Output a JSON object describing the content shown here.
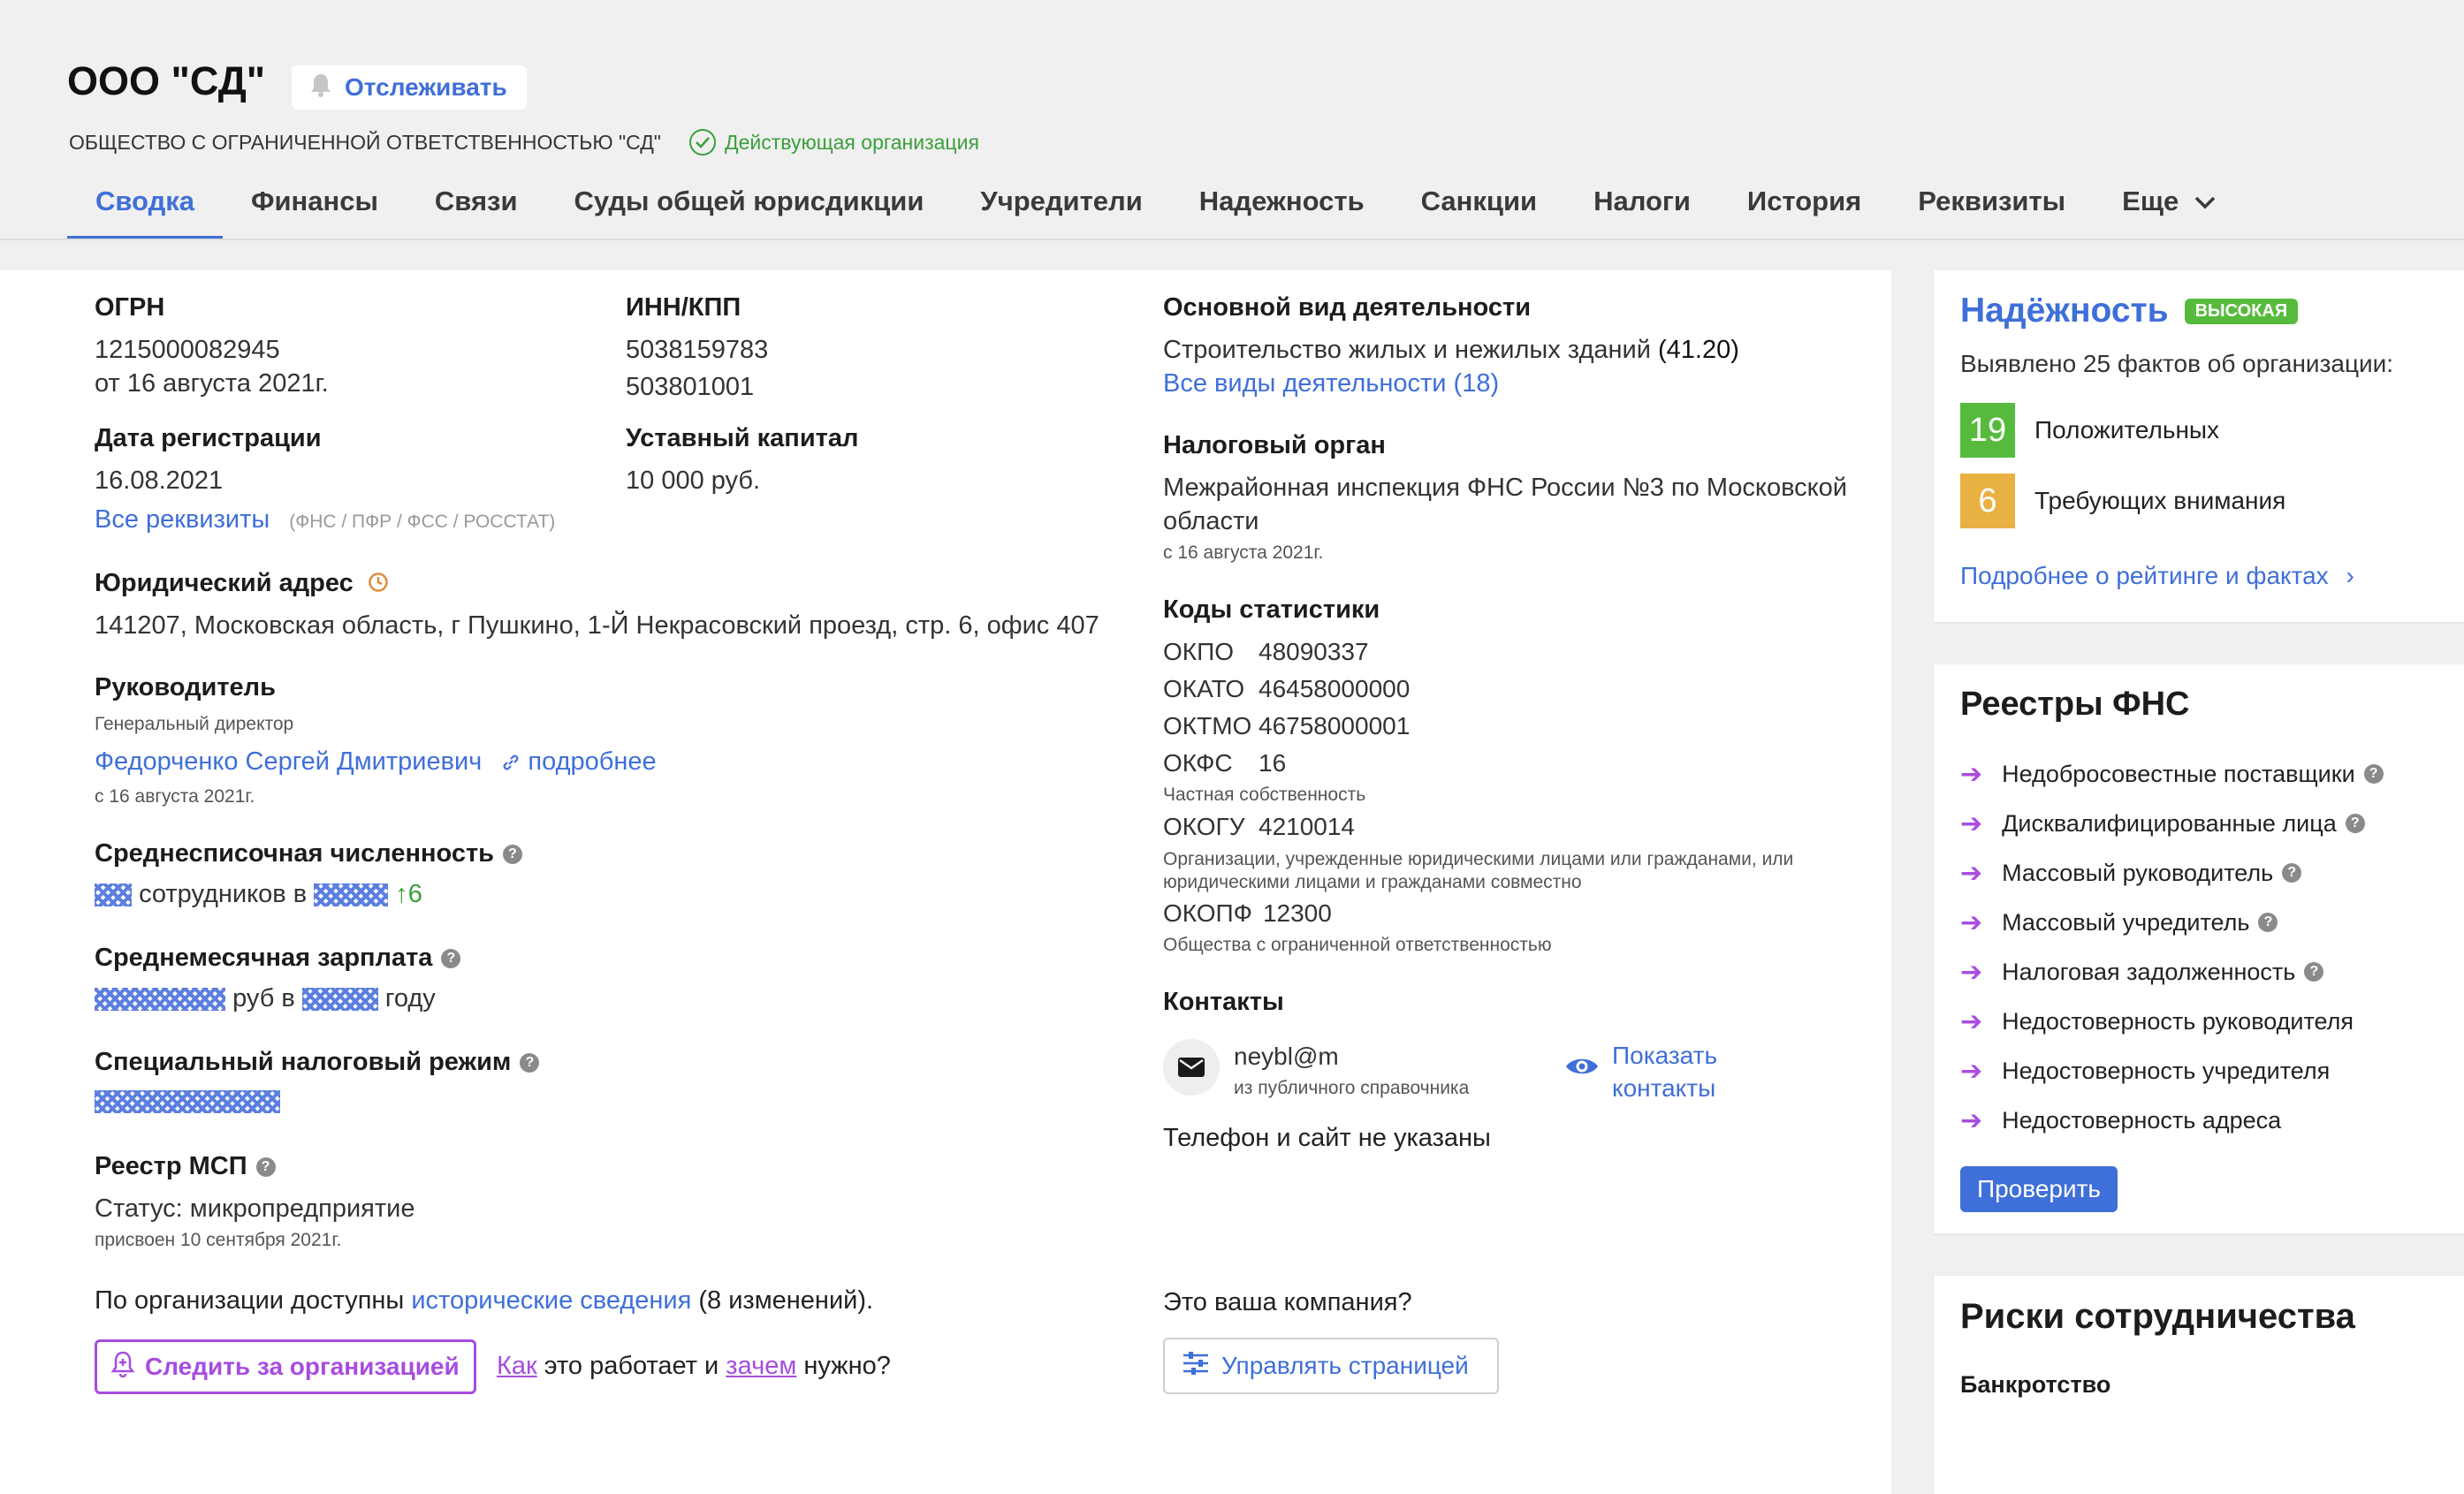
{
  "header": {
    "title": "ООО \"СД\"",
    "follow_label": "Отслеживать",
    "full_name": "ОБЩЕСТВО С ОГРАНИЧЕННОЙ ОТВЕТСТВЕННОСТЬЮ \"СД\"",
    "status": "Действующая организация"
  },
  "tabs": [
    "Сводка",
    "Финансы",
    "Связи",
    "Суды общей юрисдикции",
    "Учредители",
    "Надежность",
    "Санкции",
    "Налоги",
    "История",
    "Реквизиты",
    "Еще"
  ],
  "main": {
    "ogrn_label": "ОГРН",
    "ogrn_value": "1215000082945",
    "ogrn_date": "от 16 августа 2021г.",
    "inn_label": "ИНН/КПП",
    "inn_value": "5038159783",
    "kpp_value": "503801001",
    "regdate_label": "Дата регистрации",
    "regdate_value": "16.08.2021",
    "capital_label": "Уставный капитал",
    "capital_value": "10 000 руб.",
    "requisites_link": "Все реквизиты",
    "requisites_note": "(ФНС / ПФР / ФСС / РОССТАТ)",
    "address_label": "Юридический адрес",
    "address_value": "141207, Московская область, г Пушкино, 1-Й Некрасовский проезд, стр. 6, офис 407",
    "director_label": "Руководитель",
    "director_role": "Генеральный директор",
    "director_name": "Федорченко Сергей Дмитриевич",
    "director_more": "подробнее",
    "director_since": "с 16 августа 2021г.",
    "headcount_label": "Среднесписочная численность",
    "headcount_mid": "сотрудников в",
    "headcount_delta": "↑6",
    "salary_label": "Среднемесячная зарплата",
    "salary_mid": "руб в",
    "salary_end": "году",
    "taxmode_label": "Специальный налоговый режим",
    "msp_label": "Реестр МСП",
    "msp_status": "Статус: микропредприятие",
    "msp_date": "присвоен 10 сентября 2021г.",
    "history_pre": "По организации доступны",
    "history_link": "исторические сведения",
    "history_post": "(8 изменений).",
    "track_button": "Следить за организацией",
    "how_link": "Как",
    "how_mid": "это работает и",
    "why_link": "зачем",
    "why_post": "нужно?"
  },
  "right_col": {
    "activity_label": "Основной вид деятельности",
    "activity_value": "Строительство жилых и нежилых зданий",
    "activity_code": "(41.20)",
    "activity_all": "Все виды деятельности (18)",
    "tax_label": "Налоговый орган",
    "tax_value_1": "Межрайонная инспекция ФНС России №3 по Московской",
    "tax_value_2": "области",
    "tax_since": "с 16 августа 2021г.",
    "codes_label": "Коды статистики",
    "codes": [
      {
        "k": "ОКПО",
        "v": "48090337",
        "note": ""
      },
      {
        "k": "ОКАТО",
        "v": "46458000000",
        "note": ""
      },
      {
        "k": "ОКТМО",
        "v": "46758000001",
        "note": ""
      },
      {
        "k": "ОКФС",
        "v": "16",
        "note": "Частная собственность"
      },
      {
        "k": "ОКОГУ",
        "v": "4210014",
        "note": "Организации, учрежденные юридическими лицами или гражданами, или юридическими лицами и гражданами совместно"
      },
      {
        "k": "ОКОПФ",
        "v": "12300",
        "note": "Общества с ограниченной ответственностью"
      }
    ],
    "contacts_label": "Контакты",
    "email": "neybl@m",
    "email_note": "из публичного справочника",
    "show_contacts_1": "Показать",
    "show_contacts_2": "контакты",
    "no_phone": "Телефон и сайт не указаны",
    "your_company": "Это ваша компания?",
    "manage_button": "Управлять страницей"
  },
  "reliability": {
    "title": "Надёжность",
    "badge": "ВЫСОКАЯ",
    "facts": "Выявлено 25 фактов об организации:",
    "positive_count": "19",
    "positive_label": "Положительных",
    "attention_count": "6",
    "attention_label": "Требующих внимания",
    "more_link": "Подробнее о рейтинге и фактах",
    "colors": {
      "positive": "#56bb3c",
      "attention": "#e9b141",
      "badge": "#56bb3c"
    }
  },
  "registry": {
    "title": "Реестры ФНС",
    "items": [
      "Недобросовестные поставщики",
      "Дисквалифицированные лица",
      "Массовый руководитель",
      "Массовый учредитель",
      "Налоговая задолженность",
      "Недостоверность руководителя",
      "Недостоверность учредителя",
      "Недостоверность адреса"
    ],
    "check_button": "Проверить"
  },
  "risks": {
    "title": "Риски сотрудничества",
    "bankruptcy": "Банкротство"
  }
}
